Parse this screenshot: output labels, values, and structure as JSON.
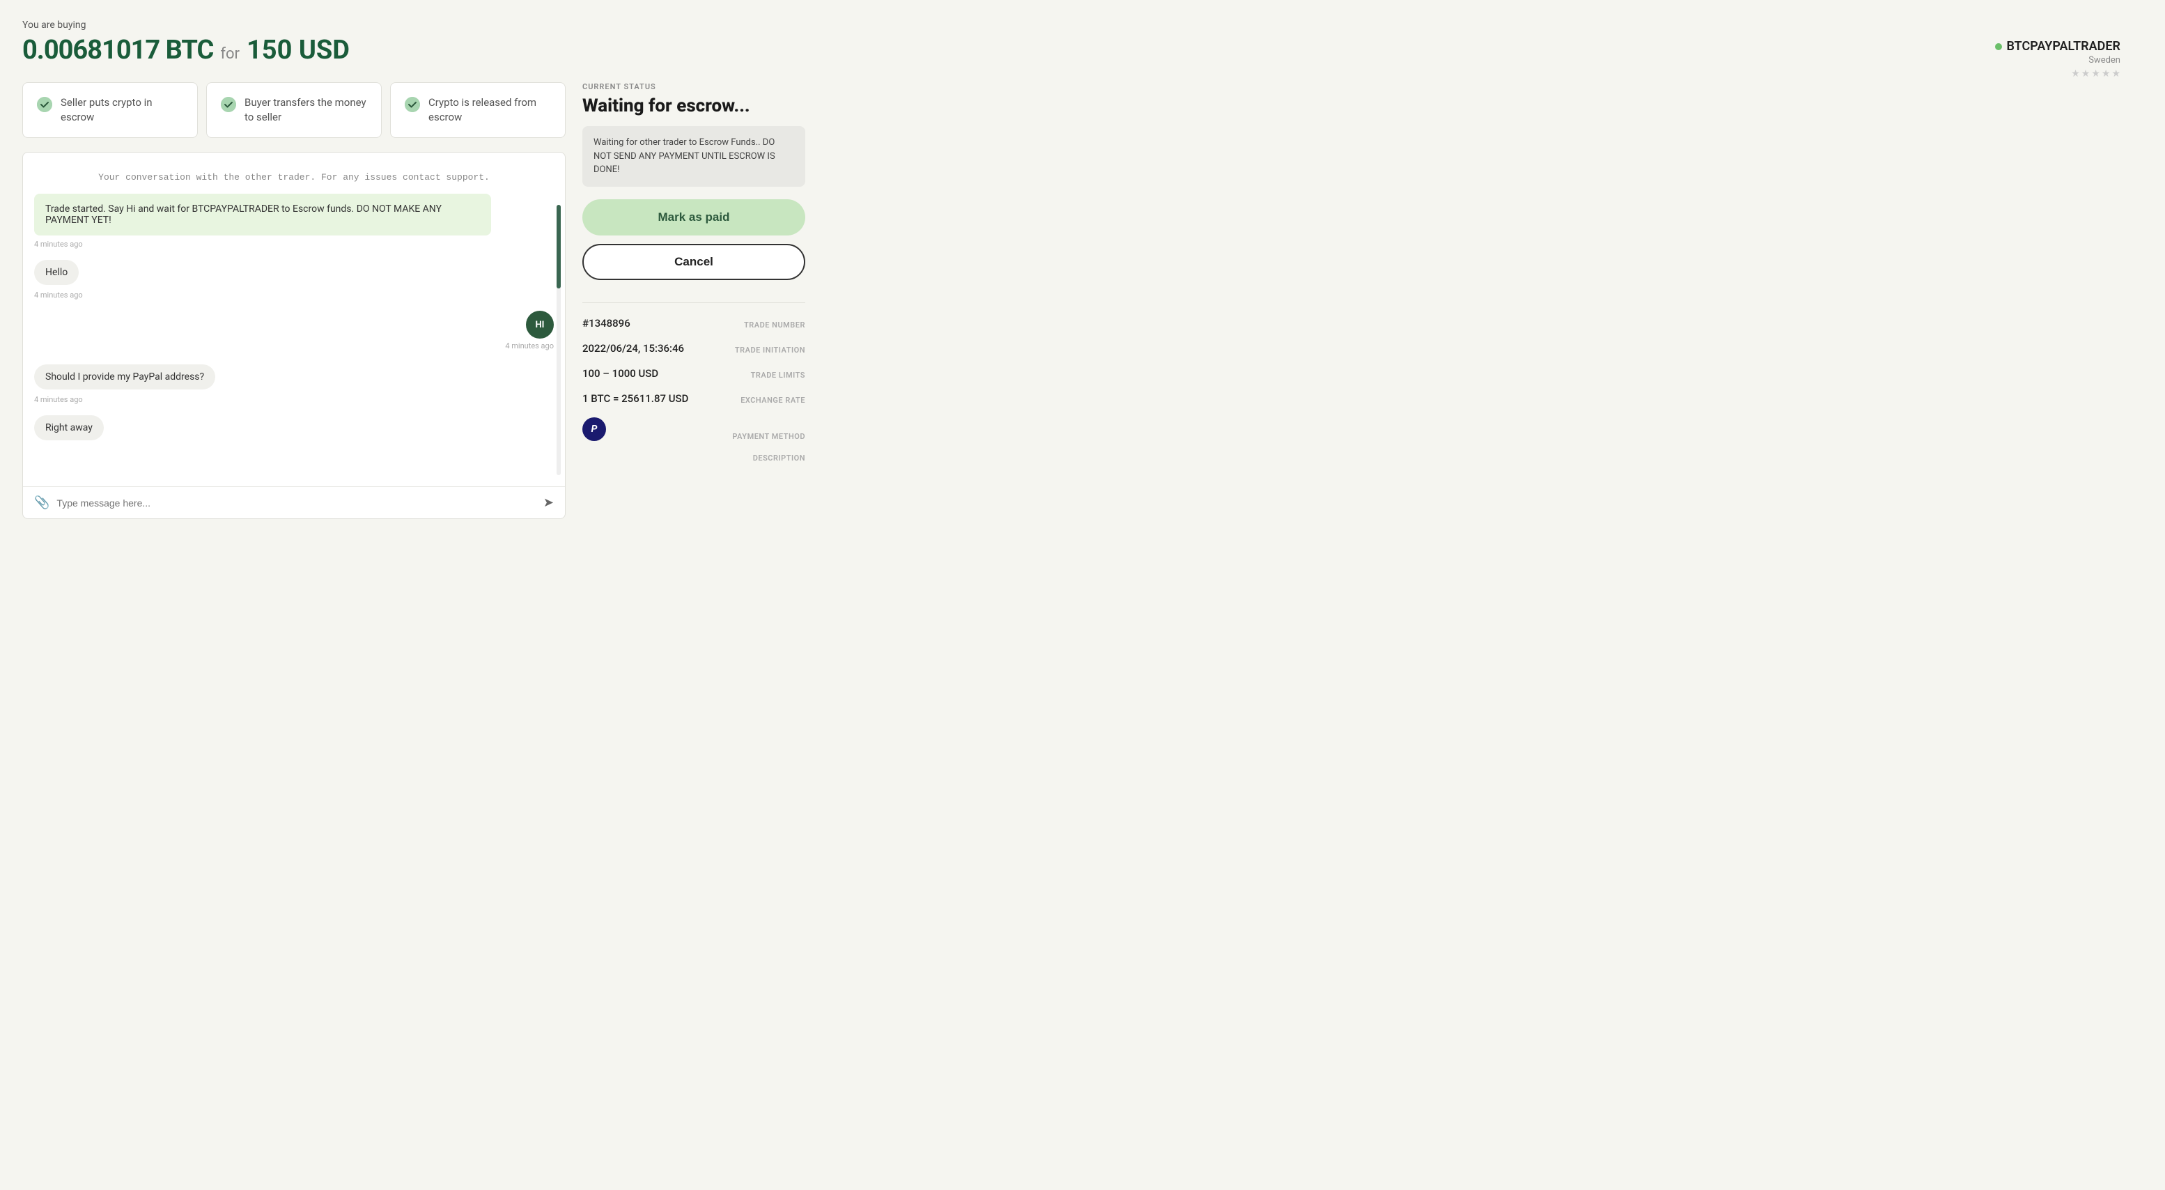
{
  "header": {
    "you_are_buying": "You are buying",
    "btc_amount": "0.00681017 BTC",
    "for_label": "for",
    "usd_amount": "150 USD"
  },
  "trader": {
    "name": "BTCPAYPALTRADER",
    "country": "Sweden",
    "stars": [
      false,
      false,
      false,
      false,
      false
    ]
  },
  "steps": [
    {
      "id": 1,
      "text": "Seller puts crypto in escrow"
    },
    {
      "id": 2,
      "text": "Buyer transfers the money to seller"
    },
    {
      "id": 3,
      "text": "Crypto is released from escrow"
    }
  ],
  "chat": {
    "notice": "Your conversation with the other trader. For any issues contact support.",
    "messages": [
      {
        "type": "system",
        "text": "Trade started. Say Hi and wait for BTCPAYPALTRADER to Escrow funds. DO NOT MAKE ANY PAYMENT YET!",
        "time": "4 minutes ago"
      },
      {
        "type": "left",
        "text": "Hello",
        "time": "4 minutes ago"
      },
      {
        "type": "right",
        "text": "HI",
        "time": "4 minutes ago",
        "avatar": "HI"
      },
      {
        "type": "left",
        "text": "Should I provide my PayPal address?",
        "time": "4 minutes ago"
      },
      {
        "type": "left",
        "text": "Right away",
        "time": ""
      }
    ],
    "input_placeholder": "Type message here..."
  },
  "status": {
    "current_status_label": "CURRENT STATUS",
    "heading": "Waiting for escrow...",
    "notice": "Waiting for other trader to Escrow Funds.. DO NOT SEND ANY PAYMENT UNTIL ESCROW IS DONE!",
    "btn_mark_paid": "Mark as paid",
    "btn_cancel": "Cancel"
  },
  "trade_details": {
    "trade_number_label": "TRADE NUMBER",
    "trade_number_value": "#1348896",
    "trade_initiation_label": "TRADE INITIATION",
    "trade_initiation_value": "2022/06/24, 15:36:46",
    "trade_limits_label": "TRADE LIMITS",
    "trade_limits_value": "100 – 1000 USD",
    "exchange_rate_label": "EXCHANGE RATE",
    "exchange_rate_value": "1 BTC = 25611.87 USD",
    "payment_method_label": "PAYMENT METHOD",
    "payment_icon": "P",
    "description_label": "DESCRIPTION"
  }
}
